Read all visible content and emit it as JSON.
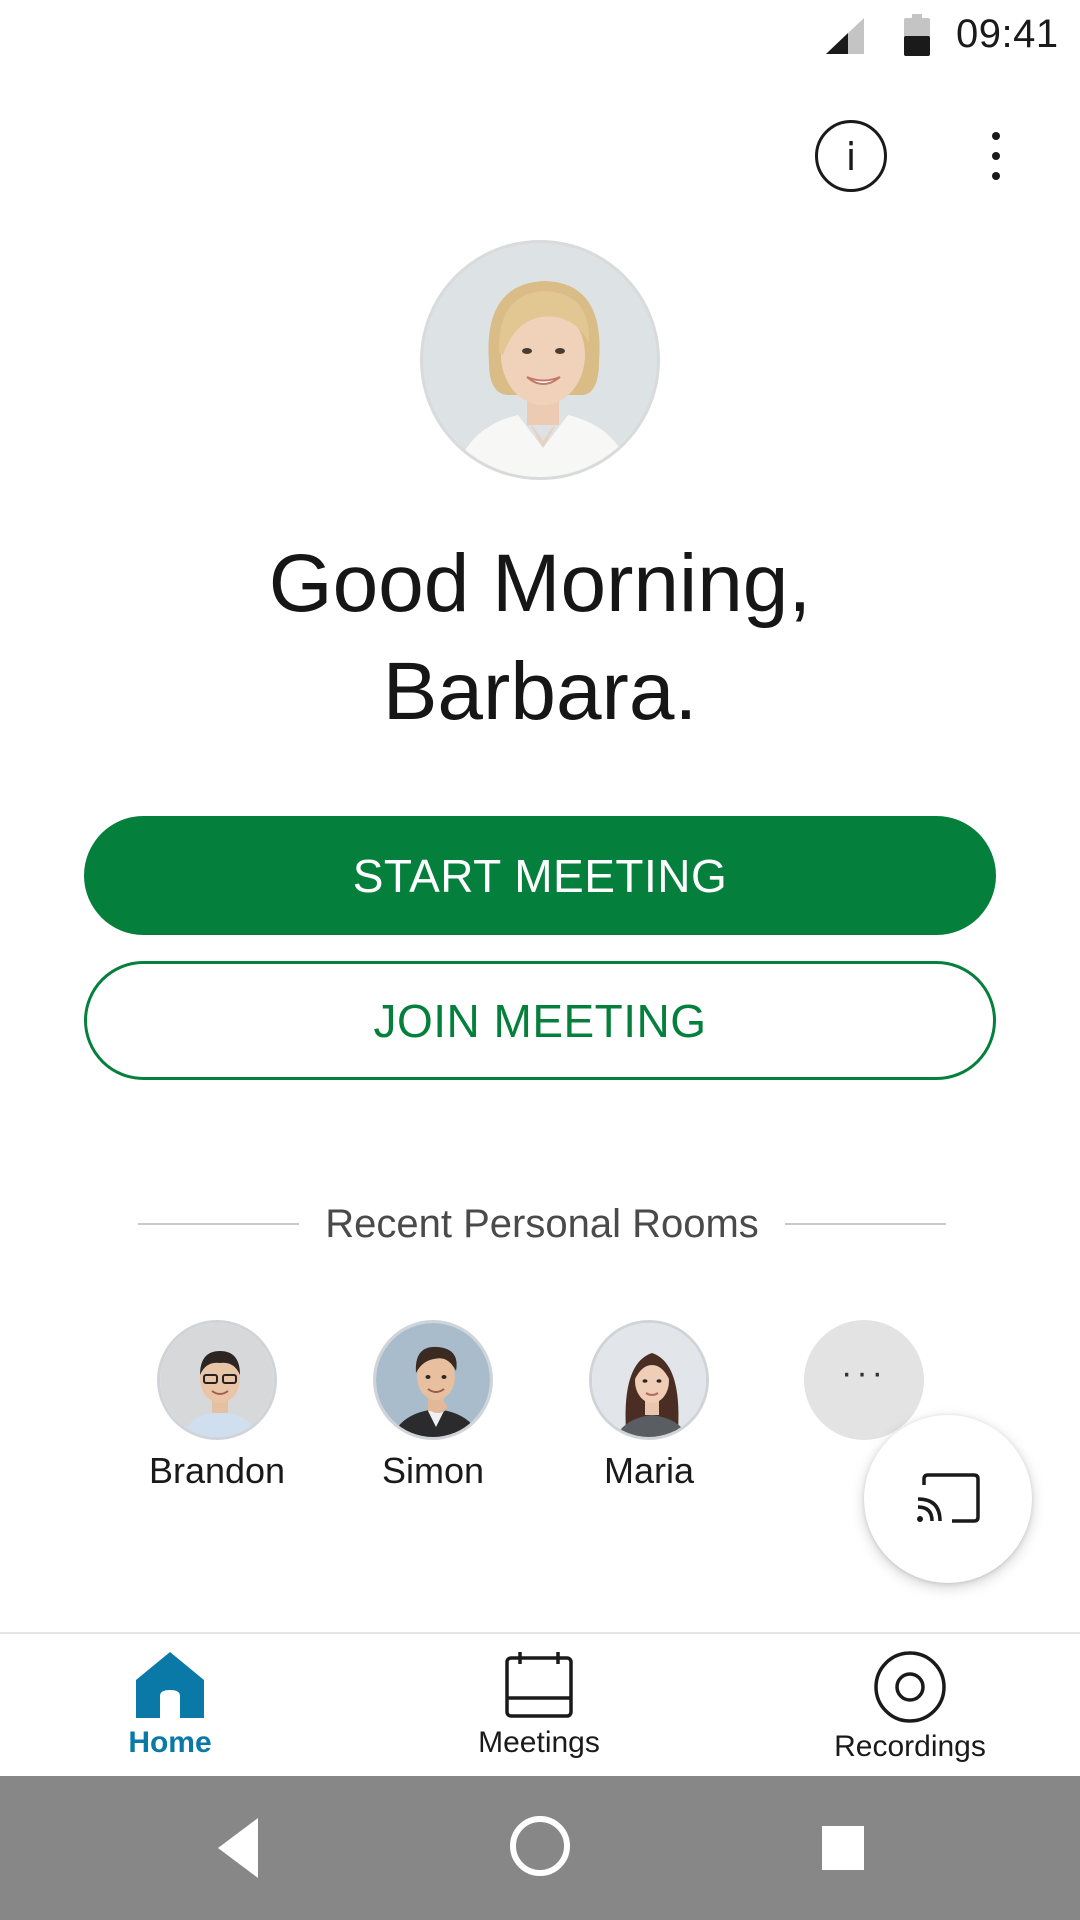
{
  "status_bar": {
    "time": "09:41",
    "signal_icon": "signal-icon",
    "battery_icon": "battery-icon"
  },
  "top_actions": {
    "info_label": "i",
    "info_icon": "info-icon",
    "overflow_icon": "overflow-menu-icon"
  },
  "profile": {
    "avatar": "user-avatar"
  },
  "greeting": {
    "line1": "Good Morning,",
    "line2": "Barbara."
  },
  "actions": {
    "start_label": "START MEETING",
    "join_label": "JOIN MEETING"
  },
  "recent_rooms": {
    "title": "Recent Personal Rooms",
    "rooms": [
      {
        "name": "Brandon"
      },
      {
        "name": "Simon"
      },
      {
        "name": "Maria"
      }
    ],
    "more_label": "···"
  },
  "cast": {
    "icon": "cast-icon"
  },
  "bottom_nav": {
    "items": [
      {
        "label": "Home",
        "icon": "home-icon",
        "active": true
      },
      {
        "label": "Meetings",
        "icon": "calendar-icon",
        "active": false
      },
      {
        "label": "Recordings",
        "icon": "record-icon",
        "active": false
      }
    ]
  },
  "colors": {
    "primary": "#05803c",
    "nav_active": "#0a79a8",
    "system_nav": "#878787"
  }
}
